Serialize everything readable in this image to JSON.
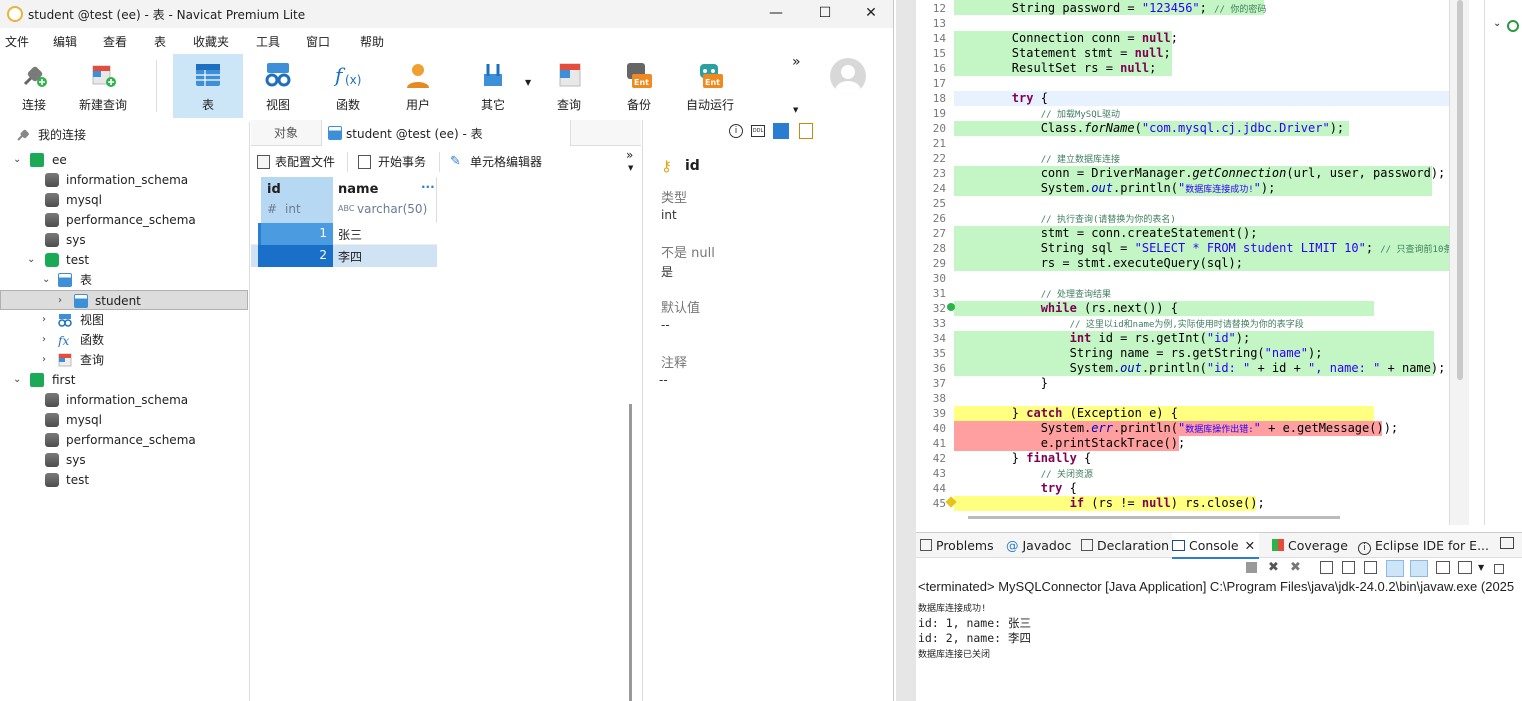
{
  "navicat": {
    "window_title": "student @test (ee) - 表 - Navicat Premium Lite",
    "menu": [
      "文件",
      "编辑",
      "查看",
      "表",
      "收藏夹",
      "工具",
      "窗口",
      "帮助"
    ],
    "toolbar": [
      "连接",
      "新建查询",
      "表",
      "视图",
      "函数",
      "用户",
      "其它",
      "查询",
      "备份",
      "自动运行"
    ],
    "toolbar_overflow": "»",
    "tree": {
      "root": "我的连接",
      "conn1": "ee",
      "conn1_dbs": [
        "information_schema",
        "mysql",
        "performance_schema",
        "sys"
      ],
      "test_db": "test",
      "tables_folder": "表",
      "student": "student",
      "views": "视图",
      "functions": "函数",
      "queries": "查询",
      "conn2": "first",
      "conn2_dbs": [
        "information_schema",
        "mysql",
        "performance_schema",
        "sys",
        "test"
      ]
    },
    "tabs": {
      "objects": "对象",
      "student": "student @test (ee) - 表"
    },
    "subtoolbar": {
      "table_profile": "表配置文件",
      "begin_tx": "开始事务",
      "cell_editor": "单元格编辑器"
    },
    "grid": {
      "columns": [
        {
          "name": "id",
          "type": "int",
          "type_icon": "#"
        },
        {
          "name": "name",
          "type": "varchar(50)",
          "type_icon": "ABC"
        }
      ],
      "rows": [
        {
          "id": "1",
          "name": "张三"
        },
        {
          "id": "2",
          "name": "李四"
        }
      ]
    },
    "info": {
      "field": "id",
      "type_label": "类型",
      "type_value": "int",
      "notnull_label": "不是 null",
      "notnull_value": "是",
      "default_label": "默认值",
      "default_value": "--",
      "comment_label": "注释",
      "comment_value": "--"
    }
  },
  "eclipse": {
    "line_numbers": [
      "12",
      "13",
      "14",
      "15",
      "16",
      "17",
      "18",
      "19",
      "20",
      "21",
      "22",
      "23",
      "24",
      "25",
      "26",
      "27",
      "28",
      "29",
      "30",
      "31",
      "32",
      "33",
      "34",
      "35",
      "36",
      "37",
      "38",
      "39",
      "40",
      "41",
      "42",
      "43",
      "44",
      "45"
    ],
    "console_tabs": [
      "Problems",
      "Javadoc",
      "Declaration",
      "Console",
      "Coverage",
      "Eclipse IDE for E..."
    ],
    "console_header": "<terminated> MySQLConnector [Java Application] C:\\Program Files\\java\\jdk-24.0.2\\bin\\javaw.exe  (2025",
    "console_lines": [
      "数据库连接成功!",
      "id: 1, name: 张三",
      "id: 2, name: 李四",
      "数据库连接已关闭"
    ],
    "colors": {
      "green": "#c4f5c4",
      "yellow": "#ffff80",
      "red": "#ff9f9f"
    }
  }
}
